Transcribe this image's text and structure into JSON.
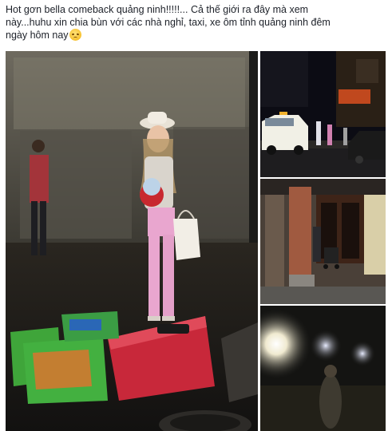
{
  "post": {
    "caption_line1": "Hot gơn bella comeback quảng ninh!!!!!... Cả thế giới ra đây mà xem",
    "caption_line2": "này...huhu xin chia bùn với các nhà nghỉ, taxi, xe ôm tỉnh quảng ninh đêm",
    "caption_line3": "ngày hôm nay",
    "emoji": "disappointed-face"
  },
  "photos": [
    {
      "name": "girl-with-luggage-photo"
    },
    {
      "name": "street-taxi-night-photo"
    },
    {
      "name": "building-stroller-photo"
    },
    {
      "name": "street-lights-night-photo"
    }
  ],
  "colors": {
    "suitcase": "#c8283a",
    "bag_green": "#3fa53a",
    "taxi": "#f1f0e6",
    "pants": "#e9a6cf"
  }
}
